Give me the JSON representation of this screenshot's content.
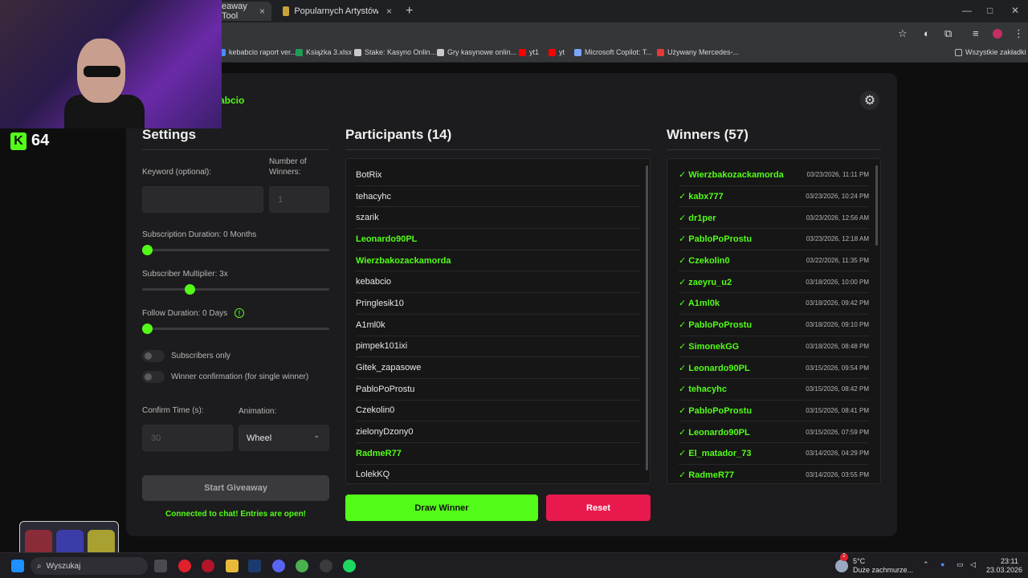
{
  "browser": {
    "tabs": [
      {
        "label": "eaway Tool",
        "active": true
      },
      {
        "label": "Popularnych Artystów - Music (",
        "active": false
      }
    ],
    "new_tab": "+",
    "bookmarks": [
      {
        "label": "kebabcio raport ver...",
        "color": "#4b8bf5"
      },
      {
        "label": "Książka 3.xlsx",
        "color": "#1f9d55"
      },
      {
        "label": "Stake: Kasyno Onlin...",
        "color": "#c9c9c9"
      },
      {
        "label": "Gry kasynowe onlin...",
        "color": "#c9c9c9"
      },
      {
        "label": "yt1",
        "color": "#ff0000"
      },
      {
        "label": "yt",
        "color": "#ff0000"
      },
      {
        "label": "Microsoft Copilot: T...",
        "color": "#7aa7ff"
      },
      {
        "label": "Używany Mercedes-...",
        "color": "#e53935"
      }
    ],
    "all_bookmarks": "Wszystkie zakładki"
  },
  "app": {
    "brand": "abcio",
    "accent": "#53fc18",
    "danger": "#e8194d"
  },
  "settings": {
    "title": "Settings",
    "keyword_label": "Keyword (optional):",
    "winners_label": "Number of Winners:",
    "winners_placeholder": "1",
    "sub_duration_label": "Subscription Duration: 0 Months",
    "sub_duration_value": 0,
    "sub_multiplier_label": "Subscriber Multiplier: 3x",
    "sub_multiplier_value": 0.24,
    "follow_label": "Follow Duration:",
    "follow_value_text": "0  Days",
    "follow_value": 0,
    "info_icon": "!",
    "subscribers_only": "Subscribers only",
    "winner_confirmation": "Winner confirmation (for single winner)",
    "confirm_time_label": "Confirm Time (s):",
    "confirm_time_placeholder": "30",
    "animation_label": "Animation:",
    "animation_value": "Wheel",
    "start_button": "Start Giveaway",
    "status": "Connected to chat! Entries are open!"
  },
  "participants": {
    "title": "Participants (14)",
    "items": [
      {
        "name": "BotRix",
        "won": false
      },
      {
        "name": "tehacyhc",
        "won": false
      },
      {
        "name": "szarik",
        "won": false
      },
      {
        "name": "Leonardo90PL",
        "won": true
      },
      {
        "name": "Wierzbakozackamorda",
        "won": true
      },
      {
        "name": "kebabcio",
        "won": false
      },
      {
        "name": "Pringlesik10",
        "won": false
      },
      {
        "name": "A1ml0k",
        "won": false
      },
      {
        "name": "pimpek101ixi",
        "won": false
      },
      {
        "name": "Gitek_zapasowe",
        "won": false
      },
      {
        "name": "PabloPoProstu",
        "won": false
      },
      {
        "name": "Czekolin0",
        "won": false
      },
      {
        "name": "zielonyDzony0",
        "won": false
      },
      {
        "name": "RadmeR77",
        "won": true
      },
      {
        "name": "LolekKQ",
        "won": false
      }
    ],
    "draw_button": "Draw Winner",
    "reset_button": "Reset"
  },
  "winners": {
    "title": "Winners (57)",
    "items": [
      {
        "name": "✓ Wierzbakozackamorda",
        "date": "03/23/2026, 11:11 PM"
      },
      {
        "name": "✓ kabx777",
        "date": "03/23/2026, 10:24 PM"
      },
      {
        "name": "✓ dr1per",
        "date": "03/23/2026, 12:56 AM"
      },
      {
        "name": "✓ PabloPoProstu",
        "date": "03/23/2026, 12:18 AM"
      },
      {
        "name": "✓ Czekolin0",
        "date": "03/22/2026, 11:35 PM"
      },
      {
        "name": "✓ zaeyru_u2",
        "date": "03/18/2026, 10:00 PM"
      },
      {
        "name": "✓ A1ml0k",
        "date": "03/18/2026, 09:42 PM"
      },
      {
        "name": "✓ PabloPoProstu",
        "date": "03/18/2026, 09:10 PM"
      },
      {
        "name": "✓ SimonekGG",
        "date": "03/18/2026, 08:48 PM"
      },
      {
        "name": "✓ Leonardo90PL",
        "date": "03/15/2026, 09:54 PM"
      },
      {
        "name": "✓ tehacyhc",
        "date": "03/15/2026, 08:42 PM"
      },
      {
        "name": "✓ PabloPoProstu",
        "date": "03/15/2026, 08:41 PM"
      },
      {
        "name": "✓ Leonardo90PL",
        "date": "03/15/2026, 07:59 PM"
      },
      {
        "name": "✓ El_matador_73",
        "date": "03/14/2026, 04:29 PM"
      },
      {
        "name": "✓ RadmeR77",
        "date": "03/14/2026, 03:55 PM"
      }
    ]
  },
  "overlay": {
    "counter": "64",
    "kick_letter": "K"
  },
  "taskbar": {
    "search": "Wyszukaj",
    "weather_temp": "5°C",
    "weather_text": "Duże zachmurze...",
    "time": "23:11",
    "date": "23.03.2026",
    "badge": "2"
  }
}
